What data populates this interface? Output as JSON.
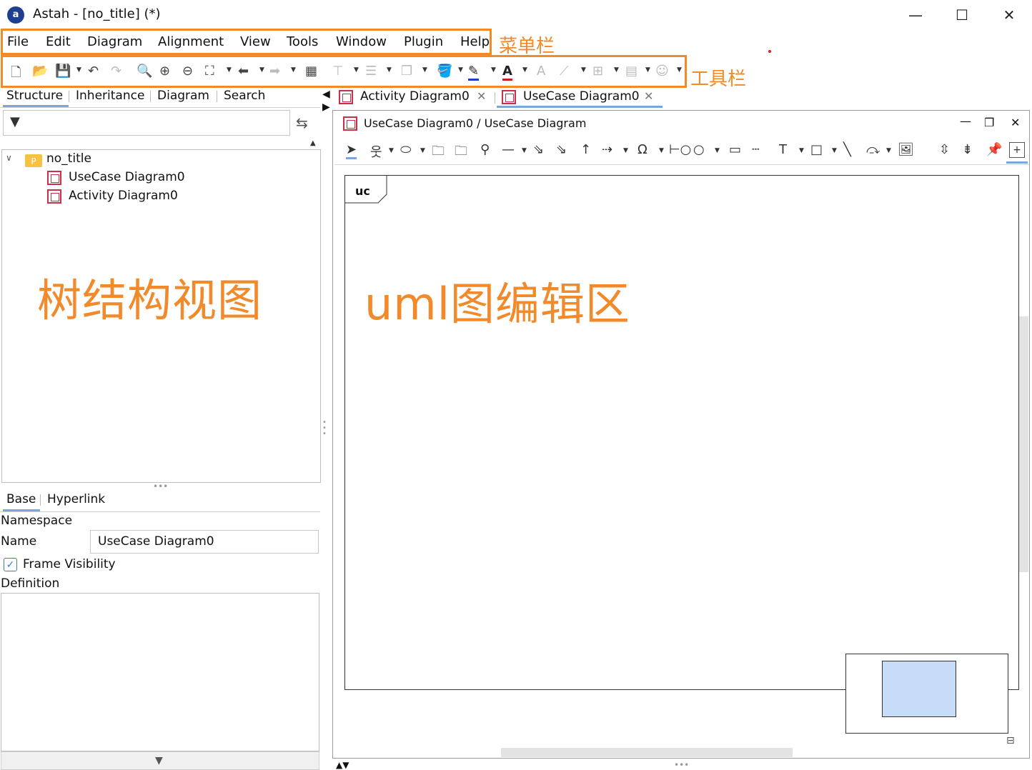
{
  "window": {
    "title": "Astah - [no_title] (*)",
    "logo": "a",
    "minimize": "—",
    "maximize": "☐",
    "close": "✕"
  },
  "menu": {
    "items": [
      "File",
      "Edit",
      "Diagram",
      "Alignment",
      "View",
      "Tools",
      "Window",
      "Plugin",
      "Help"
    ],
    "annotation": "菜单栏"
  },
  "toolbar": {
    "annotation": "工具栏"
  },
  "left_tabs": [
    "Structure",
    "Inheritance",
    "Diagram",
    "Search"
  ],
  "tree": {
    "root": "no_title",
    "root_icon": "P",
    "children": [
      "UseCase Diagram0",
      "Activity Diagram0"
    ],
    "annotation": "树结构视图"
  },
  "props": {
    "tabs": [
      "Base",
      "Hyperlink"
    ],
    "namespace_label": "Namespace",
    "name_label": "Name",
    "name_value": "UseCase Diagram0",
    "frame_visibility_label": "Frame Visibility",
    "frame_visibility_checked": true,
    "definition_label": "Definition"
  },
  "doc_tabs": [
    "Activity Diagram0",
    "UseCase Diagram0"
  ],
  "diagram": {
    "title": "UseCase Diagram0 / UseCase Diagram",
    "frame_label": "uc",
    "annotation": "uml图编辑区"
  },
  "colors": {
    "accent_orange": "#f08a2a",
    "diagram_icon": "#c9304a",
    "overview_viewport": "#c6dcf7",
    "tab_underline": "#7aa7d8"
  }
}
